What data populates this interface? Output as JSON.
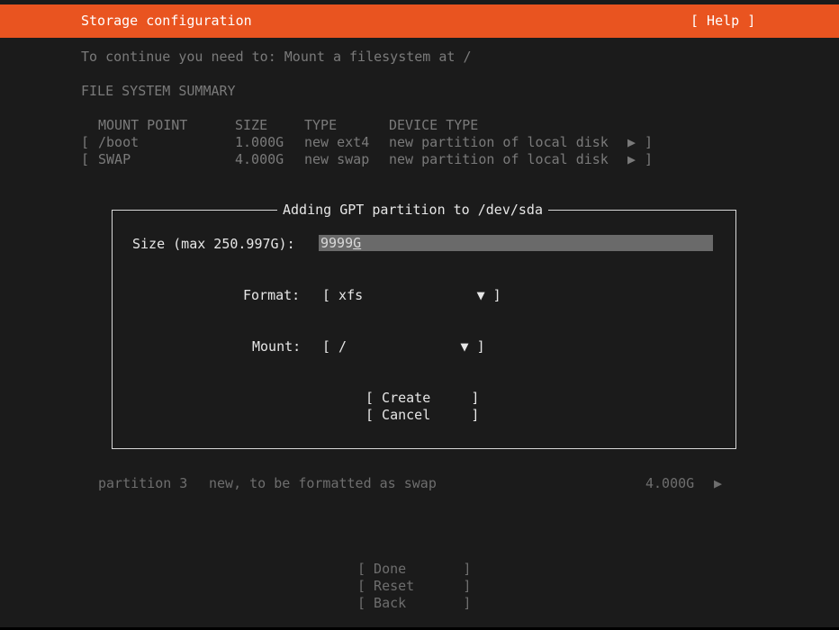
{
  "header": {
    "title": "Storage configuration",
    "help_label": "[ Help ]"
  },
  "instruction": "To continue you need to: Mount a filesystem at /",
  "summary": {
    "heading": "FILE SYSTEM SUMMARY",
    "columns": {
      "mount_point": "MOUNT POINT",
      "size": "SIZE",
      "type": "TYPE",
      "device_type": "DEVICE TYPE"
    },
    "rows": [
      {
        "open": "[",
        "mount": "/boot",
        "size": "1.000G",
        "type": "new ext4",
        "device": "new partition of local disk",
        "arrow": "▶",
        "close": "]"
      },
      {
        "open": "[",
        "mount": "SWAP",
        "size": "4.000G",
        "type": "new swap",
        "device": "new partition of local disk",
        "arrow": "▶",
        "close": "]"
      }
    ]
  },
  "dialog": {
    "title": "Adding GPT partition to /dev/sda",
    "size_label": "Size (max 250.997G):",
    "size_value": "9999",
    "size_cursor": "G",
    "format_label": "Format:",
    "format_value": "[ xfs              ▼ ]",
    "mount_label": "Mount:",
    "mount_value": "[ /              ▼ ]",
    "create_label": "[ Create     ]",
    "cancel_label": "[ Cancel     ]"
  },
  "partition_row": {
    "name": "partition 3",
    "desc": "new, to be formatted as swap",
    "size": "4.000G",
    "arrow": "▶"
  },
  "footer": {
    "done_label": "[ Done       ]",
    "reset_label": "[ Reset      ]",
    "back_label": "[ Back       ]"
  },
  "colors": {
    "accent": "#e95420",
    "background": "#1b1b1b"
  }
}
